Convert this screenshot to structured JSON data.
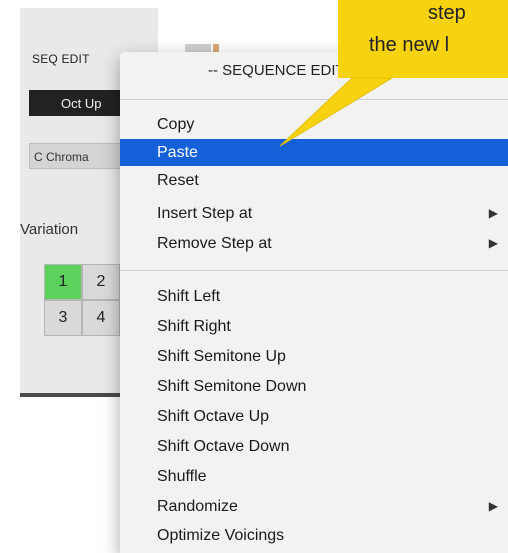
{
  "background_panel": {
    "title": "SEQ EDIT",
    "octave_button": "Oct Up",
    "scale_field": "C Chroma",
    "variation_label": "Variation",
    "variations": [
      "1",
      "2",
      "3",
      "4"
    ]
  },
  "callout": {
    "line1": "step",
    "line2": "the new l"
  },
  "menu": {
    "header": "-- SEQUENCE EDIT --",
    "items": [
      {
        "label": "Copy",
        "submenu": false
      },
      {
        "label": "Paste",
        "submenu": false,
        "highlighted": true
      },
      {
        "label": "Reset",
        "submenu": false
      },
      {
        "label": "Insert Step at",
        "submenu": true
      },
      {
        "label": "Remove Step at",
        "submenu": true
      },
      {
        "label": "Shift Left",
        "submenu": false
      },
      {
        "label": "Shift Right",
        "submenu": false
      },
      {
        "label": "Shift Semitone Up",
        "submenu": false
      },
      {
        "label": "Shift Semitone Down",
        "submenu": false
      },
      {
        "label": "Shift Octave Up",
        "submenu": false
      },
      {
        "label": "Shift Octave Down",
        "submenu": false
      },
      {
        "label": "Shuffle",
        "submenu": false
      },
      {
        "label": "Randomize",
        "submenu": true
      },
      {
        "label": "Optimize Voicings",
        "submenu": false
      }
    ],
    "submenu_arrow_icon": "triangle-right-icon",
    "arrow_glyph": "▶"
  },
  "colors": {
    "highlight": "#1460d8",
    "callout": "#f6d20f",
    "active_variation": "#5cd15c"
  }
}
